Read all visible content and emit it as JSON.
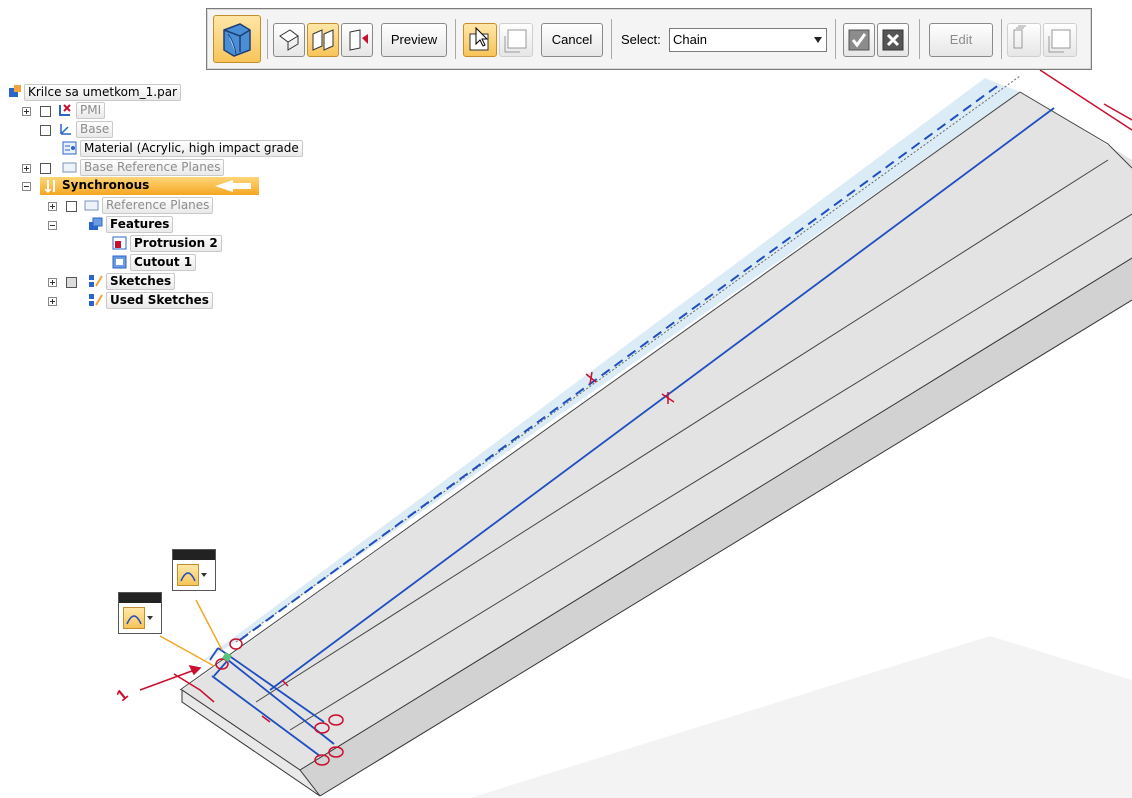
{
  "toolbar": {
    "preview_label": "Preview",
    "cancel_label": "Cancel",
    "select_label": "Select:",
    "select_value": "Chain",
    "edit_label": "Edit",
    "icons": {
      "main": "extrude-solid-icon",
      "mode1": "single-face-icon",
      "mode2": "multi-face-icon",
      "mode3": "direction-arrow-icon",
      "step1": "select-step-icon",
      "step2": "extent-step-icon",
      "accept": "checkmark-icon",
      "reject": "close-icon",
      "extra": "pattern-icon"
    }
  },
  "tree": {
    "root": "Krilce sa umetkom_1.par",
    "pmi": "PMI",
    "base": "Base",
    "material": "Material (Acrylic, high impact grade",
    "base_ref_planes": "Base Reference Planes",
    "synchronous": "Synchronous",
    "ref_planes": "Reference Planes",
    "features": "Features",
    "protrusion": "Protrusion 2",
    "cutout": "Cutout 1",
    "sketches": "Sketches",
    "used_sketches": "Used Sketches"
  },
  "viewport": {
    "dimension_value": "1"
  },
  "colors": {
    "accent": "#f5a623",
    "selection_blue": "#1f4fbf",
    "dimension_red": "#c8102e"
  }
}
